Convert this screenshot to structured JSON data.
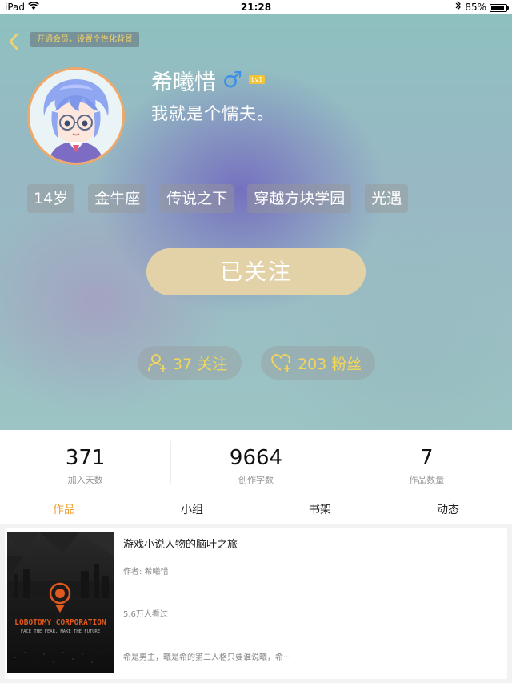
{
  "status_bar": {
    "device": "iPad",
    "time": "21:28",
    "battery": "85%",
    "battery_level": 0.85
  },
  "header": {
    "vip_banner": "开通会员，设置个性化背景",
    "username": "希曦惜",
    "gender_symbol": "♂",
    "level": "Lv1",
    "signature": "我就是个懦夫。",
    "tags": [
      "14岁",
      "金牛座",
      "传说之下",
      "穿越方块学园",
      "光遇"
    ],
    "follow_button": "已关注",
    "following": "37 关注",
    "fans": "203 粉丝"
  },
  "counts": [
    {
      "value": "371",
      "label": "加入天数"
    },
    {
      "value": "9664",
      "label": "创作字数"
    },
    {
      "value": "7",
      "label": "作品数量"
    }
  ],
  "tabs": [
    "作品",
    "小组",
    "书架",
    "动态"
  ],
  "active_tab": "作品",
  "work": {
    "cover_title": "LOBOTOMY CORPORATION",
    "cover_subtitle": "FACE THE FEAR, MAKE THE FUTURE",
    "title": "游戏小说人物的脑叶之旅",
    "author": "作者: 希曦惜",
    "views": "5.6万人看过",
    "description": "希是男主，曦是希的第二人格只要谁说曦，希···"
  },
  "colors": {
    "accent": "#f0a030",
    "stat_text": "#f3d65a",
    "follow_button_bg": "#e3d2a8",
    "gender": "#3b8fe6",
    "level_badge": "#f1c43a",
    "cover_title": "#e0591e"
  }
}
